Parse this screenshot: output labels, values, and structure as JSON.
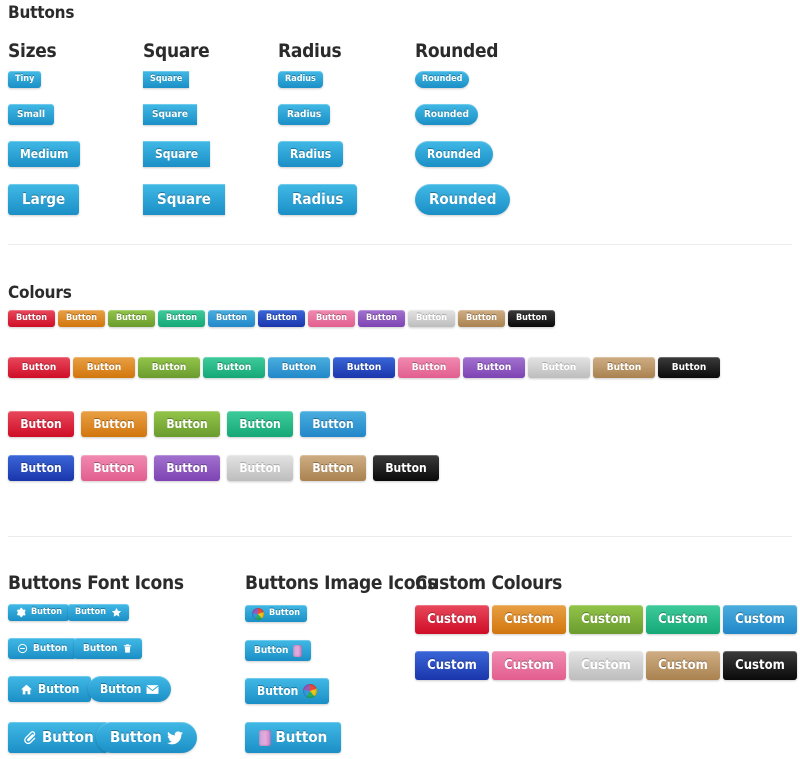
{
  "page": {
    "title": "Buttons",
    "background": "#ffffff",
    "heading_color": "#2b2b2b",
    "rule_color": "#ececec"
  },
  "sections": {
    "shapes": {
      "columns": [
        {
          "title": "Sizes",
          "shape": "default",
          "buttons": [
            {
              "label": "Tiny",
              "size": "tiny"
            },
            {
              "label": "Small",
              "size": "small"
            },
            {
              "label": "Medium",
              "size": "medium"
            },
            {
              "label": "Large",
              "size": "large"
            }
          ]
        },
        {
          "title": "Square",
          "shape": "square",
          "buttons": [
            {
              "label": "Square",
              "size": "tiny"
            },
            {
              "label": "Square",
              "size": "small"
            },
            {
              "label": "Square",
              "size": "medium"
            },
            {
              "label": "Square",
              "size": "large"
            }
          ]
        },
        {
          "title": "Radius",
          "shape": "radius",
          "buttons": [
            {
              "label": "Radius",
              "size": "tiny"
            },
            {
              "label": "Radius",
              "size": "small"
            },
            {
              "label": "Radius",
              "size": "medium"
            },
            {
              "label": "Radius",
              "size": "large"
            }
          ]
        },
        {
          "title": "Rounded",
          "shape": "rounded",
          "buttons": [
            {
              "label": "Rounded",
              "size": "tiny"
            },
            {
              "label": "Rounded",
              "size": "small"
            },
            {
              "label": "Rounded",
              "size": "medium"
            },
            {
              "label": "Rounded",
              "size": "large"
            }
          ]
        }
      ]
    },
    "colours": {
      "title": "Colours",
      "label": "Button",
      "palette": [
        {
          "name": "red",
          "top": "#e8485c",
          "bottom": "#cf0d26"
        },
        {
          "name": "orange",
          "top": "#e8a044",
          "bottom": "#d2760d"
        },
        {
          "name": "green",
          "top": "#93c54b",
          "bottom": "#6a9b2e"
        },
        {
          "name": "teal",
          "top": "#3fcb9b",
          "bottom": "#15a877"
        },
        {
          "name": "blue",
          "top": "#4aaede",
          "bottom": "#2287c9"
        },
        {
          "name": "navy",
          "top": "#3a66d8",
          "bottom": "#1b36ac"
        },
        {
          "name": "pink",
          "top": "#f08ab0",
          "bottom": "#e25e8e"
        },
        {
          "name": "purple",
          "top": "#a272cf",
          "bottom": "#7e43b3"
        },
        {
          "name": "silver",
          "top": "#e3e3e3",
          "bottom": "#bdbdbd"
        },
        {
          "name": "tan",
          "top": "#cfad84",
          "bottom": "#a9824f"
        },
        {
          "name": "black",
          "top": "#3b3b3b",
          "bottom": "#0a0a0a"
        }
      ],
      "rows": [
        {
          "size": "tiny",
          "count": 11
        },
        {
          "size": "small",
          "count": 11
        },
        {
          "size": "medium",
          "count": 11
        }
      ]
    },
    "font_icons": {
      "title": "Buttons Font Icons",
      "label": "Button",
      "buttons": [
        {
          "label": "Button",
          "icon": "gear-icon",
          "icon_side": "left",
          "size": "tiny",
          "shape": "default"
        },
        {
          "label": "Button",
          "icon": "star-icon",
          "icon_side": "right",
          "size": "tiny",
          "shape": "default"
        },
        {
          "label": "Button",
          "icon": "minus-circle-icon",
          "icon_side": "left",
          "size": "small",
          "shape": "default"
        },
        {
          "label": "Button",
          "icon": "trash-icon",
          "icon_side": "right",
          "size": "small",
          "shape": "default"
        },
        {
          "label": "Button",
          "icon": "home-icon",
          "icon_side": "left",
          "size": "medium",
          "shape": "default"
        },
        {
          "label": "Button",
          "icon": "envelope-icon",
          "icon_side": "right",
          "size": "medium",
          "shape": "rounded"
        },
        {
          "label": "Button",
          "icon": "paperclip-icon",
          "icon_side": "left",
          "size": "large",
          "shape": "default"
        },
        {
          "label": "Button",
          "icon": "twitter-icon",
          "icon_side": "right",
          "size": "large",
          "shape": "rounded"
        }
      ]
    },
    "image_icons": {
      "title": "Buttons Image Icons",
      "label": "Button",
      "buttons": [
        {
          "label": "Button",
          "icon": "globe-image-icon",
          "icon_side": "left",
          "size": "tiny"
        },
        {
          "label": "Button",
          "icon": "book-image-icon",
          "icon_side": "right",
          "size": "small"
        },
        {
          "label": "Button",
          "icon": "globe-image-icon",
          "icon_side": "right",
          "size": "medium"
        },
        {
          "label": "Button",
          "icon": "book-image-icon",
          "icon_side": "left",
          "size": "large"
        }
      ]
    },
    "custom_colours": {
      "title": "Custom Colours",
      "label": "Custom",
      "rows": [
        [
          "red",
          "orange",
          "green",
          "teal",
          "blue"
        ],
        [
          "navy",
          "pink",
          "silver",
          "tan",
          "black"
        ]
      ]
    }
  }
}
